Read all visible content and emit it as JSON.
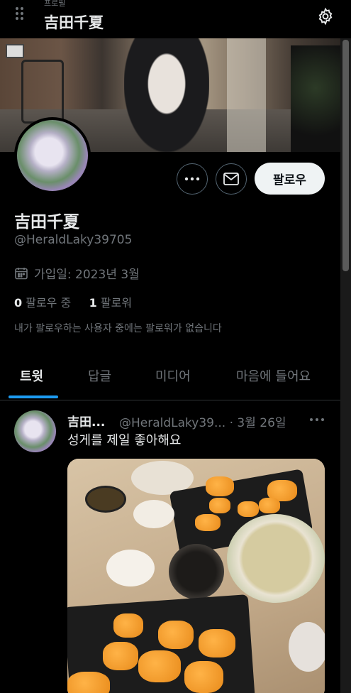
{
  "header": {
    "subtitle": "프로필",
    "title": "吉田千夏"
  },
  "profile": {
    "display_name": "吉田千夏",
    "handle": "@HeraldLaky39705",
    "joined": "가입일: 2023년 3월",
    "following_count": "0",
    "following_label": "팔로우 중",
    "followers_count": "1",
    "followers_label": "팔로워",
    "follow_button": "팔로우",
    "no_mutuals": "내가 팔로우하는 사용자 중에는 팔로워가 없습니다"
  },
  "tabs": [
    {
      "label": "트윗",
      "active": true
    },
    {
      "label": "답글"
    },
    {
      "label": "미디어"
    },
    {
      "label": "마음에 들어요"
    }
  ],
  "tweet": {
    "name": "吉田...",
    "meta": "@HeraldLaky39... · 3월 26일",
    "text": "성게를 제일 좋아해요"
  },
  "icons": [
    "drag-handle-icon",
    "gear-icon",
    "more-icon",
    "mail-icon",
    "calendar-icon"
  ],
  "colors": {
    "accent": "#1d9bf0",
    "background": "#000000",
    "text_primary": "#e7e9ea",
    "text_secondary": "#71767b"
  }
}
